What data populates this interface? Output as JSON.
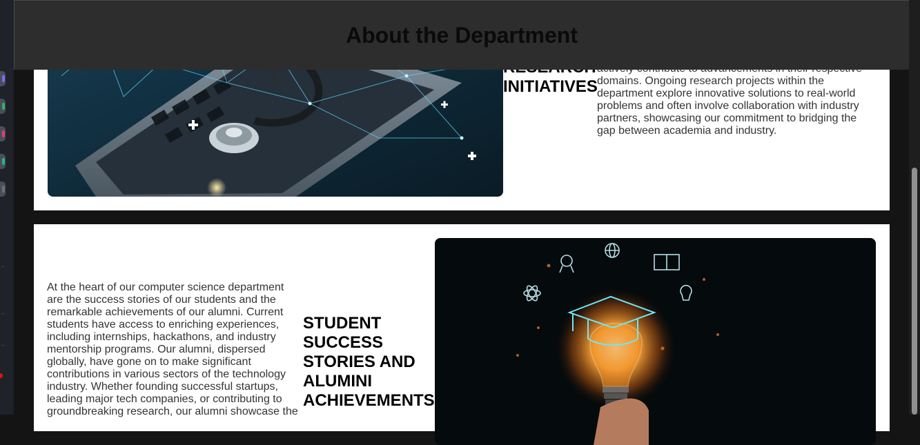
{
  "header": {
    "title": "About the Department"
  },
  "research": {
    "heading": "RESEARCH INITIATIVES",
    "text": "actively contribute to advancements in their respective domains. Ongoing research projects within the department explore innovative solutions to real-world problems and often involve collaboration with industry partners, showcasing our commitment to bridging the gap between academia and industry.",
    "image_icon": "stethoscope-laptop-image"
  },
  "students": {
    "heading": "STUDENT SUCCESS STORIES AND ALUMINI ACHIEVEMENTS",
    "text": "At the heart of our computer science department are the success stories of our students and the remarkable achievements of our alumni. Current students have access to enriching experiences, including internships, hackathons, and industry mentorship programs. Our alumni, dispersed globally, have gone on to make significant contributions in various sectors of the technology industry. Whether founding successful startups, leading major tech companies, or contributing to groundbreaking research, our alumni showcase the",
    "image_icon": "graduation-lightbulb-image"
  },
  "colors": {
    "page_background": "#141414",
    "header_background": "#2d2d2d",
    "card_background": "#ffffff",
    "heading_text": "#000000",
    "body_text": "#333333"
  }
}
